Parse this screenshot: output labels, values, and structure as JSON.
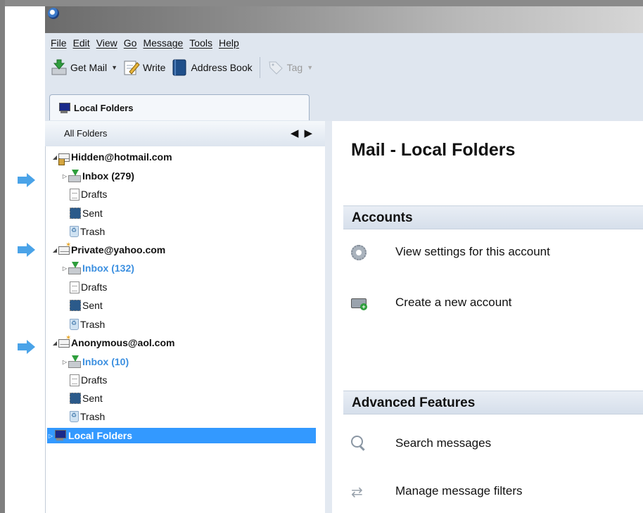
{
  "menu": [
    "File",
    "Edit",
    "View",
    "Go",
    "Message",
    "Tools",
    "Help"
  ],
  "toolbar": {
    "get_mail": "Get Mail",
    "write": "Write",
    "address_book": "Address Book",
    "tag": "Tag"
  },
  "tab": {
    "label": "Local Folders"
  },
  "sidebar": {
    "header": "All Folders",
    "accounts": [
      {
        "name": "Hidden@hotmail.com",
        "inbox": "Inbox (279)",
        "drafts": "Drafts",
        "sent": "Sent",
        "trash": "Trash"
      },
      {
        "name": "Private@yahoo.com",
        "inbox": "Inbox (132)",
        "drafts": "Drafts",
        "sent": "Sent",
        "trash": "Trash"
      },
      {
        "name": "Anonymous@aol.com",
        "inbox": "Inbox (10)",
        "drafts": "Drafts",
        "sent": "Sent",
        "trash": "Trash"
      }
    ],
    "local_folders": "Local Folders"
  },
  "main": {
    "title": "Mail - Local Folders",
    "accounts_heading": "Accounts",
    "view_settings": "View settings for this account",
    "create_account": "Create a new account",
    "advanced_heading": "Advanced Features",
    "search_messages": "Search messages",
    "manage_filters": "Manage message filters"
  },
  "colors": {
    "accent": "#3399ff",
    "unread_inbox": "#3b8fe0",
    "arrow": "#4aa3e8"
  }
}
